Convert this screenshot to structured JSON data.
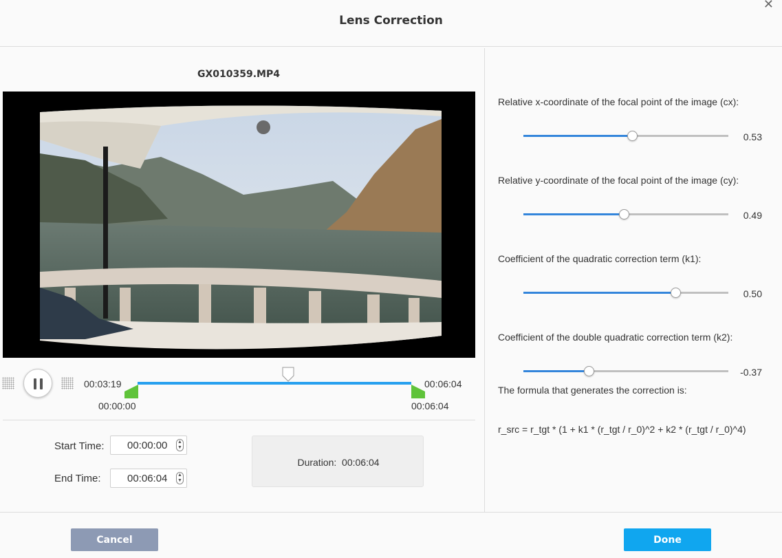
{
  "dialog": {
    "title": "Lens Correction",
    "close_icon": "close-icon"
  },
  "video": {
    "filename": "GX010359.MP4"
  },
  "timeline": {
    "current_time": "00:03:19",
    "clip_start": "00:00:00",
    "clip_end_top": "00:06:04",
    "clip_end_bottom": "00:06:04",
    "playhead_fraction": 0.55
  },
  "trim": {
    "start_label": "Start Time:",
    "start_value": "00:00:00",
    "end_label": "End Time:",
    "end_value": "00:06:04",
    "duration_label": "Duration:",
    "duration_value": "00:06:04"
  },
  "params": [
    {
      "label": "Relative x-coordinate of the focal point of the image (cx):",
      "value": "0.53",
      "fraction": 0.53
    },
    {
      "label": "Relative y-coordinate of the focal point of the image (cy):",
      "value": "0.49",
      "fraction": 0.49
    },
    {
      "label": "Coefficient of the quadratic correction term (k1):",
      "value": "0.50",
      "fraction": 0.74
    },
    {
      "label": "Coefficient of the double quadratic correction term (k2):",
      "value": "-0.37",
      "fraction": 0.32
    }
  ],
  "formula": {
    "intro": "The formula that generates the correction is:",
    "text": "r_src = r_tgt * (1 + k1 * (r_tgt / r_0)^2 + k2 * (r_tgt / r_0)^4)"
  },
  "footer": {
    "cancel_label": "Cancel",
    "done_label": "Done"
  },
  "colors": {
    "accent": "#10a6ef",
    "slider_fill": "#3385db",
    "trim_handle": "#5fc33a",
    "cancel_bg": "#8d9ab4"
  }
}
